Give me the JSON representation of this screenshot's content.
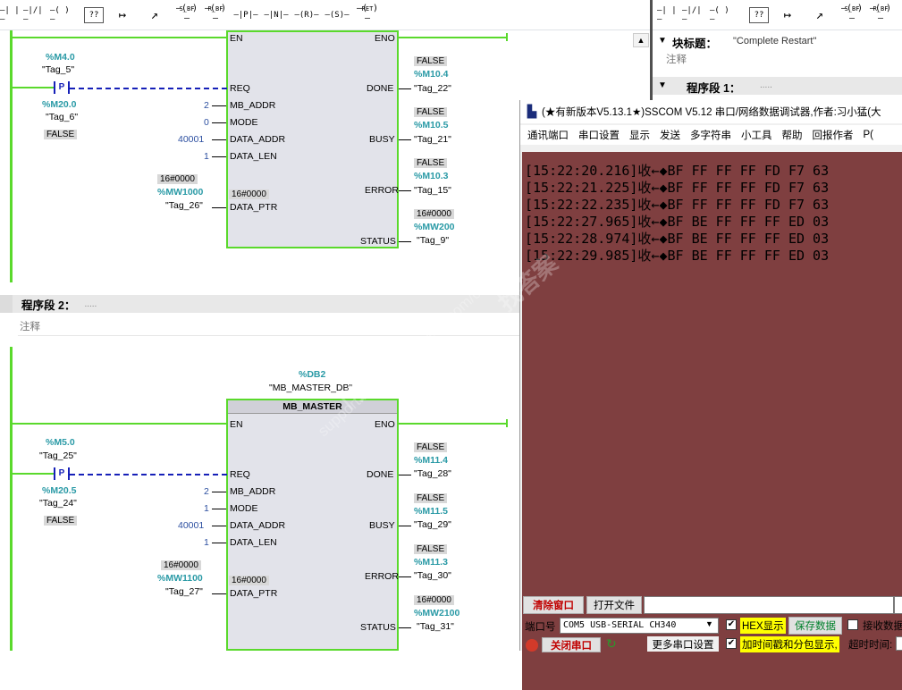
{
  "toolbar": {
    "buttons": [
      "—| |—",
      "—|/|—",
      "—( )—",
      "??",
      "↦",
      "↗",
      "S_BF",
      "R_BF",
      "—|P|—",
      "—|N|—",
      "—(R)—",
      "—(S)—",
      "RET"
    ],
    "right_buttons": [
      "—| |—",
      "—|/|—",
      "—( )—",
      "??",
      "↦",
      "↗",
      "S_BF",
      "R_BF"
    ],
    "sbf_sym": "—( )—",
    "ret_sym": "—( )—"
  },
  "network1": {
    "block": {
      "en": "EN",
      "eno": "ENO",
      "pins_in": [
        "REQ",
        "MB_ADDR",
        "MODE",
        "DATA_ADDR",
        "DATA_LEN",
        "DATA_PTR"
      ],
      "pins_out": [
        "DONE",
        "BUSY",
        "ERROR",
        "STATUS"
      ],
      "ptr_inner": "16#0000"
    },
    "contact": {
      "addr1": "%M4.0",
      "tag1": "\"Tag_5\"",
      "p": "P",
      "addr2": "%M20.0",
      "tag2": "\"Tag_6\"",
      "state": "FALSE"
    },
    "inputs": {
      "mb_addr": "2",
      "mode": "0",
      "data_addr": "40001",
      "data_len": "1",
      "ptr_val": "16#0000",
      "ptr_addr": "%MW1000",
      "ptr_tag": "\"Tag_26\""
    },
    "outputs": {
      "done": {
        "state": "FALSE",
        "addr": "%M10.4",
        "tag": "\"Tag_22\""
      },
      "busy": {
        "state": "FALSE",
        "addr": "%M10.5",
        "tag": "\"Tag_21\""
      },
      "error": {
        "state": "FALSE",
        "addr": "%M10.3",
        "tag": "\"Tag_15\""
      },
      "status": {
        "state": "16#0000",
        "addr": "%MW200",
        "tag": "\"Tag_9\""
      }
    }
  },
  "network2": {
    "header": "程序段 2：",
    "header_dots": ".....",
    "comment": "注释",
    "db": {
      "addr": "%DB2",
      "name": "\"MB_MASTER_DB\"",
      "title": "MB_MASTER"
    },
    "block": {
      "en": "EN",
      "eno": "ENO",
      "pins_in": [
        "REQ",
        "MB_ADDR",
        "MODE",
        "DATA_ADDR",
        "DATA_LEN",
        "DATA_PTR"
      ],
      "pins_out": [
        "DONE",
        "BUSY",
        "ERROR",
        "STATUS"
      ],
      "ptr_inner": "16#0000"
    },
    "contact": {
      "addr1": "%M5.0",
      "tag1": "\"Tag_25\"",
      "p": "P",
      "addr2": "%M20.5",
      "tag2": "\"Tag_24\"",
      "state": "FALSE"
    },
    "inputs": {
      "mb_addr": "2",
      "mode": "1",
      "data_addr": "40001",
      "data_len": "1",
      "ptr_val": "16#0000",
      "ptr_addr": "%MW1100",
      "ptr_tag": "\"Tag_27\""
    },
    "outputs": {
      "done": {
        "state": "FALSE",
        "addr": "%M11.4",
        "tag": "\"Tag_28\""
      },
      "busy": {
        "state": "FALSE",
        "addr": "%M11.5",
        "tag": "\"Tag_29\""
      },
      "error": {
        "state": "FALSE",
        "addr": "%M11.3",
        "tag": "\"Tag_30\""
      },
      "status": {
        "state": "16#0000",
        "addr": "%MW2100",
        "tag": "\"Tag_31\""
      }
    }
  },
  "right_panel": {
    "block_title_label": "块标题：",
    "block_title_value": "\"Complete Restart\"",
    "comment": "注释",
    "network1_label": "程序段 1：",
    "network1_dots": "....."
  },
  "sscom": {
    "title": "(★有新版本V5.13.1★)SSCOM V5.12 串口/网络数据调试器,作者:习小猛(大",
    "menu": [
      "通讯端口",
      "串口设置",
      "显示",
      "发送",
      "多字符串",
      "小工具",
      "帮助",
      "回报作者",
      "P("
    ],
    "lines": [
      "[15:22:20.216]收←◆BF FF FF FF FD F7 63",
      "[15:22:21.225]收←◆BF FF FF FF FD F7 63",
      "[15:22:22.235]收←◆BF FF FF FF FD F7 63",
      "[15:22:27.965]收←◆BF BE FF FF FF ED 03",
      "[15:22:28.974]收←◆BF BE FF FF FF ED 03",
      "[15:22:29.985]收←◆BF BE FF FF FF ED 03"
    ],
    "watermark1": "找答案",
    "watermark2": "support.industry.siemens.com/cs",
    "watermark3": "门子工业",
    "clear_btn": "清除窗口",
    "open_file_btn": "打开文件",
    "port_label": "端口号",
    "port_value": "COM5 USB-SERIAL CH340",
    "hex_label": "HEX显示",
    "save_btn": "保存数据",
    "recv_label": "接收数据",
    "close_btn": "关闭串口",
    "more_btn": "更多串口设置",
    "timestamp_label": "加时间戳和分包显示,",
    "timeout_label": "超时时间:"
  }
}
